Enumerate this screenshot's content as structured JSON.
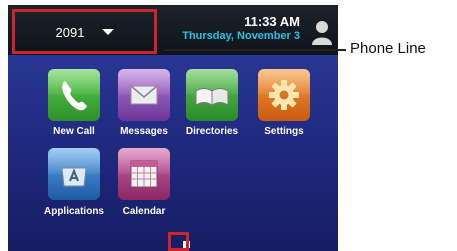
{
  "status_bar": {
    "line_number": "2091",
    "time": "11:33 AM",
    "date": "Thursday, November 3"
  },
  "apps": [
    {
      "label": "New Call",
      "icon": "phone-icon",
      "color": "#3aa63a"
    },
    {
      "label": "Messages",
      "icon": "envelope-icon",
      "color": "#8a4fb8"
    },
    {
      "label": "Directories",
      "icon": "book-icon",
      "color": "#3b9b3b"
    },
    {
      "label": "Settings",
      "icon": "gear-icon",
      "color": "#e0781f"
    },
    {
      "label": "Applications",
      "icon": "applications-icon",
      "color": "#2d6fb8"
    },
    {
      "label": "Calendar",
      "icon": "calendar-icon",
      "color": "#a8347a"
    }
  ],
  "callout": {
    "label": "Phone Line"
  },
  "colors": {
    "highlight": "#d0242c",
    "date_text": "#26c3e6"
  }
}
